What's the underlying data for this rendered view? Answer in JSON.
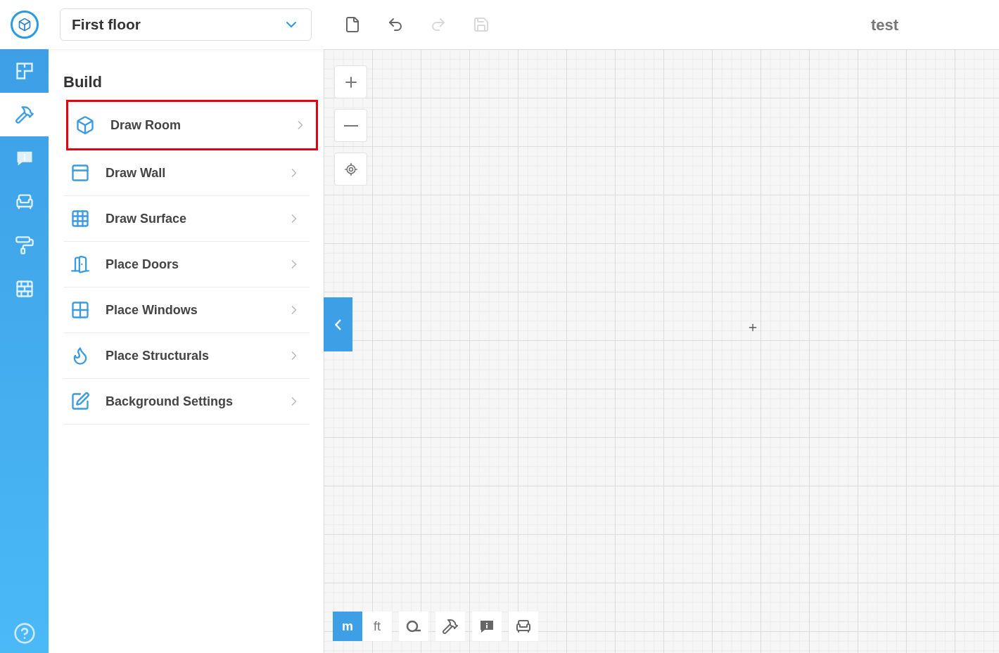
{
  "floor_select": {
    "value": "First floor"
  },
  "toolbar": [
    {
      "kind": "new",
      "disabled": false
    },
    {
      "kind": "undo",
      "disabled": false
    },
    {
      "kind": "redo",
      "disabled": true
    },
    {
      "kind": "save",
      "disabled": true
    }
  ],
  "project_title": "test",
  "rail": [
    {
      "kind": "plan",
      "selected": false
    },
    {
      "kind": "build",
      "selected": true
    },
    {
      "kind": "info",
      "selected": false
    },
    {
      "kind": "furniture",
      "selected": false
    },
    {
      "kind": "paint",
      "selected": false
    },
    {
      "kind": "bricks",
      "selected": false
    }
  ],
  "panel": {
    "title": "Build",
    "items": [
      {
        "label": "Draw Room",
        "kind": "room",
        "highlighted": true
      },
      {
        "label": "Draw Wall",
        "kind": "wall",
        "highlighted": false
      },
      {
        "label": "Draw Surface",
        "kind": "surface",
        "highlighted": false
      },
      {
        "label": "Place Doors",
        "kind": "door",
        "highlighted": false
      },
      {
        "label": "Place Windows",
        "kind": "window",
        "highlighted": false
      },
      {
        "label": "Place Structurals",
        "kind": "fireplace",
        "highlighted": false
      },
      {
        "label": "Background Settings",
        "kind": "background",
        "highlighted": false
      }
    ]
  },
  "units": [
    {
      "label": "m",
      "selected": true
    },
    {
      "label": "ft",
      "selected": false
    }
  ],
  "bottom_tools": [
    {
      "kind": "measure"
    },
    {
      "kind": "build"
    },
    {
      "kind": "info"
    },
    {
      "kind": "furniture"
    }
  ]
}
